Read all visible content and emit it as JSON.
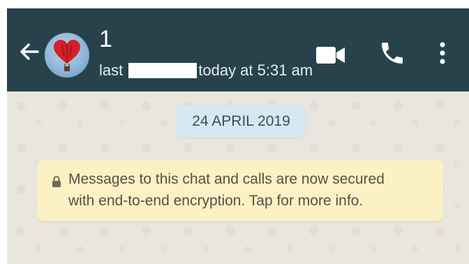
{
  "header": {
    "contact_name": "1",
    "status_prefix": "last",
    "status_suffix": "today at 5:31 am",
    "icons": {
      "back": "back-arrow-icon",
      "avatar": "heart-balloon-avatar",
      "video": "video-call-icon",
      "call": "phone-call-icon",
      "menu": "more-options-icon"
    },
    "colors": {
      "bar": "#27424b",
      "text": "#ffffff"
    }
  },
  "chat": {
    "date_label": "24 APRIL 2019",
    "encryption_notice": {
      "line1": "Messages to this chat and calls are now secured",
      "line2": "with end-to-end encryption. Tap for more info.",
      "icon": "lock-icon"
    },
    "colors": {
      "date_pill": "#d6e8f1",
      "notice": "#fbf1c4"
    }
  }
}
